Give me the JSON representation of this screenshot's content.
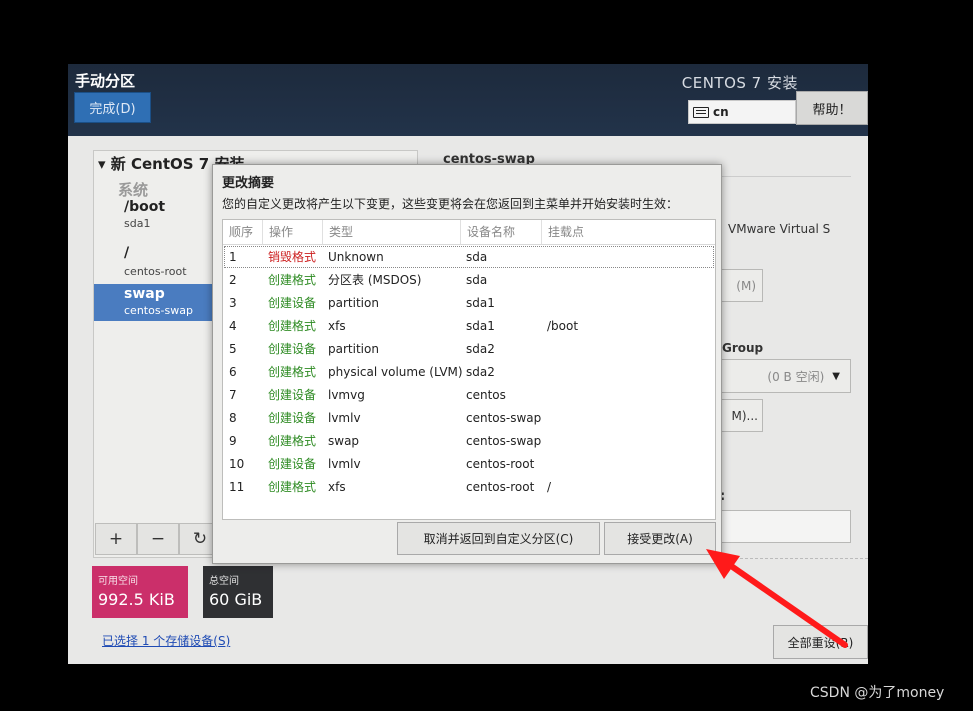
{
  "header": {
    "title": "手动分区",
    "done_label": "完成(D)",
    "install_title": "CENTOS 7 安装",
    "keyboard_layout": "cn",
    "help_label": "帮助！"
  },
  "left_panel": {
    "root_label": "新 CentOS 7 安装",
    "system_label": "系统",
    "partitions": [
      {
        "mount": "/boot",
        "device": "sda1"
      },
      {
        "mount": "/",
        "device": "centos-root"
      },
      {
        "mount": "swap",
        "device": "centos-swap"
      }
    ],
    "tools": {
      "add": "+",
      "remove": "−",
      "refresh": "↻"
    }
  },
  "space": {
    "available_label": "可用空间",
    "available_value": "992.5 KiB",
    "total_label": "总空间",
    "total_value": "60 GiB",
    "storage_link": "已选择 1 个存储设备(S)"
  },
  "right_panel": {
    "title": "centos-swap",
    "device_text": "VMware Virtual S",
    "modify_fragment": "(M)",
    "volume_group_label": "Group",
    "vg_free": "(0 B 空闲)",
    "modify2_fragment": "M)...",
    "colon": ":",
    "reset_label": "全部重设(R)"
  },
  "dialog": {
    "title": "更改摘要",
    "description": "您的自定义更改将产生以下变更，这些变更将会在您返回到主菜单并开始安装时生效：",
    "columns": {
      "order": "顺序",
      "action": "操作",
      "type": "类型",
      "device": "设备名称",
      "mount": "挂载点"
    },
    "rows": [
      {
        "n": "1",
        "action": "销毁格式",
        "kind": "destroy",
        "type": "Unknown",
        "device": "sda",
        "mount": ""
      },
      {
        "n": "2",
        "action": "创建格式",
        "kind": "create",
        "type": "分区表 (MSDOS)",
        "device": "sda",
        "mount": ""
      },
      {
        "n": "3",
        "action": "创建设备",
        "kind": "create",
        "type": "partition",
        "device": "sda1",
        "mount": ""
      },
      {
        "n": "4",
        "action": "创建格式",
        "kind": "create",
        "type": "xfs",
        "device": "sda1",
        "mount": "/boot"
      },
      {
        "n": "5",
        "action": "创建设备",
        "kind": "create",
        "type": "partition",
        "device": "sda2",
        "mount": ""
      },
      {
        "n": "6",
        "action": "创建格式",
        "kind": "create",
        "type": "physical volume (LVM)",
        "device": "sda2",
        "mount": ""
      },
      {
        "n": "7",
        "action": "创建设备",
        "kind": "create",
        "type": "lvmvg",
        "device": "centos",
        "mount": ""
      },
      {
        "n": "8",
        "action": "创建设备",
        "kind": "create",
        "type": "lvmlv",
        "device": "centos-swap",
        "mount": ""
      },
      {
        "n": "9",
        "action": "创建格式",
        "kind": "create",
        "type": "swap",
        "device": "centos-swap",
        "mount": ""
      },
      {
        "n": "10",
        "action": "创建设备",
        "kind": "create",
        "type": "lvmlv",
        "device": "centos-root",
        "mount": ""
      },
      {
        "n": "11",
        "action": "创建格式",
        "kind": "create",
        "type": "xfs",
        "device": "centos-root",
        "mount": "/"
      }
    ],
    "cancel_label": "取消并返回到自定义分区(C)",
    "accept_label": "接受更改(A)"
  },
  "colors": {
    "destroy": "#cc1f1f",
    "create": "#2e8b23",
    "accent": "#2f6fb4",
    "annotation_arrow": "#ff1a1a"
  },
  "watermark": "CSDN @为了money"
}
